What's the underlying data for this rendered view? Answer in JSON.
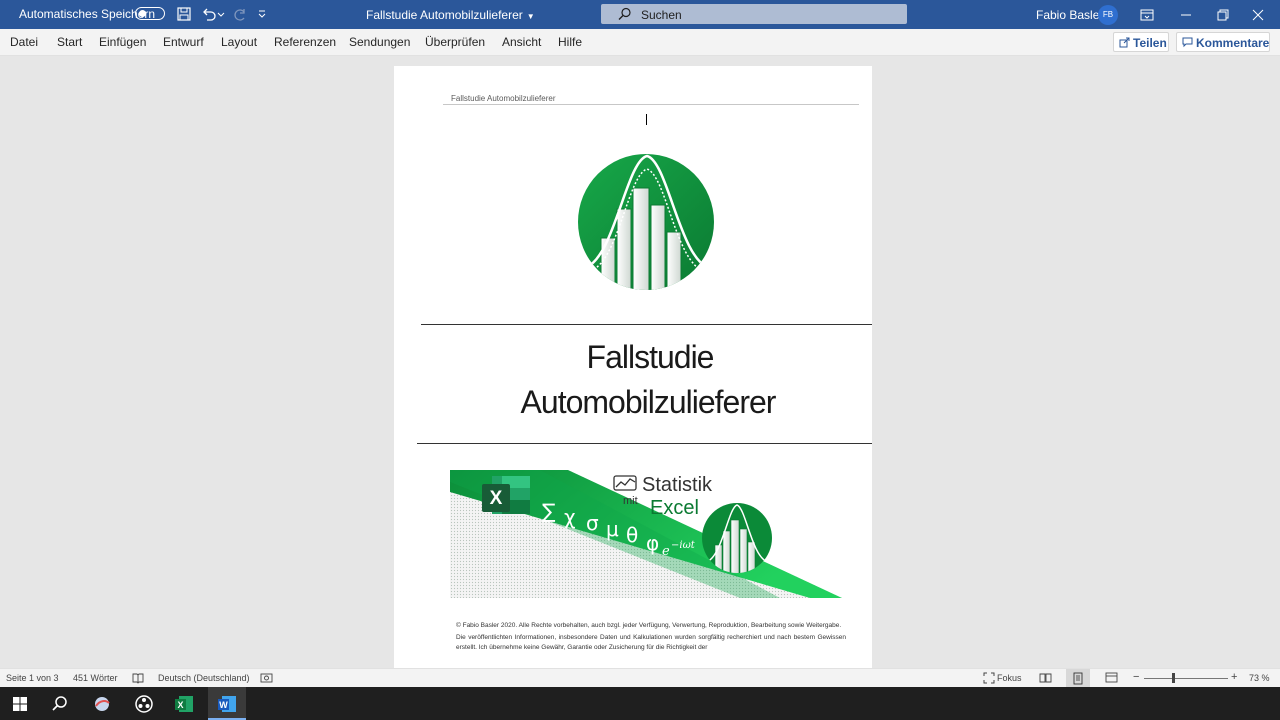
{
  "titlebar": {
    "autosave_label": "Automatisches Speichern",
    "document_title": "Fallstudie Automobilzulieferer",
    "search_placeholder": "Suchen",
    "user_name": "Fabio Basler",
    "user_initials": "FB"
  },
  "menu": {
    "items": [
      "Datei",
      "Start",
      "Einfügen",
      "Entwurf",
      "Layout",
      "Referenzen",
      "Sendungen",
      "Überprüfen",
      "Ansicht",
      "Hilfe"
    ],
    "share_label": "Teilen",
    "comments_label": "Kommentare"
  },
  "document": {
    "header_text": "Fallstudie Automobilzulieferer",
    "title_line1": "Fallstudie",
    "title_line2": "Automobilzulieferer",
    "banner": {
      "line1": "Statistik",
      "mit": "mit",
      "line2": "Excel",
      "excel_letter": "X",
      "symbols": [
        "∑",
        "χ",
        "σ",
        "μ",
        "θ",
        "φ"
      ],
      "symbol_suffix": "e",
      "superscript": "−iωt"
    },
    "copyright_para1": "© Fabio Basler 2020. Alle Rechte vorbehalten, auch bzgl. jeder Verfügung, Verwertung, Reproduktion, Bearbeitung sowie Weitergabe.",
    "copyright_para2": "Die veröffentlichten Informationen, insbesondere Daten und Kalkulationen wurden sorgfältig recherchiert und nach bestem Gewissen erstellt. Ich übernehme keine Gewähr, Garantie oder Zusicherung für die Richtigkeit der"
  },
  "statusbar": {
    "page": "Seite 1 von 3",
    "words": "451 Wörter",
    "language": "Deutsch (Deutschland)",
    "focus": "Fokus",
    "zoom": "73 %"
  },
  "colors": {
    "word_blue": "#2b579a",
    "brand_green": "#0f9d3f",
    "dark_green": "#0b7a32"
  }
}
